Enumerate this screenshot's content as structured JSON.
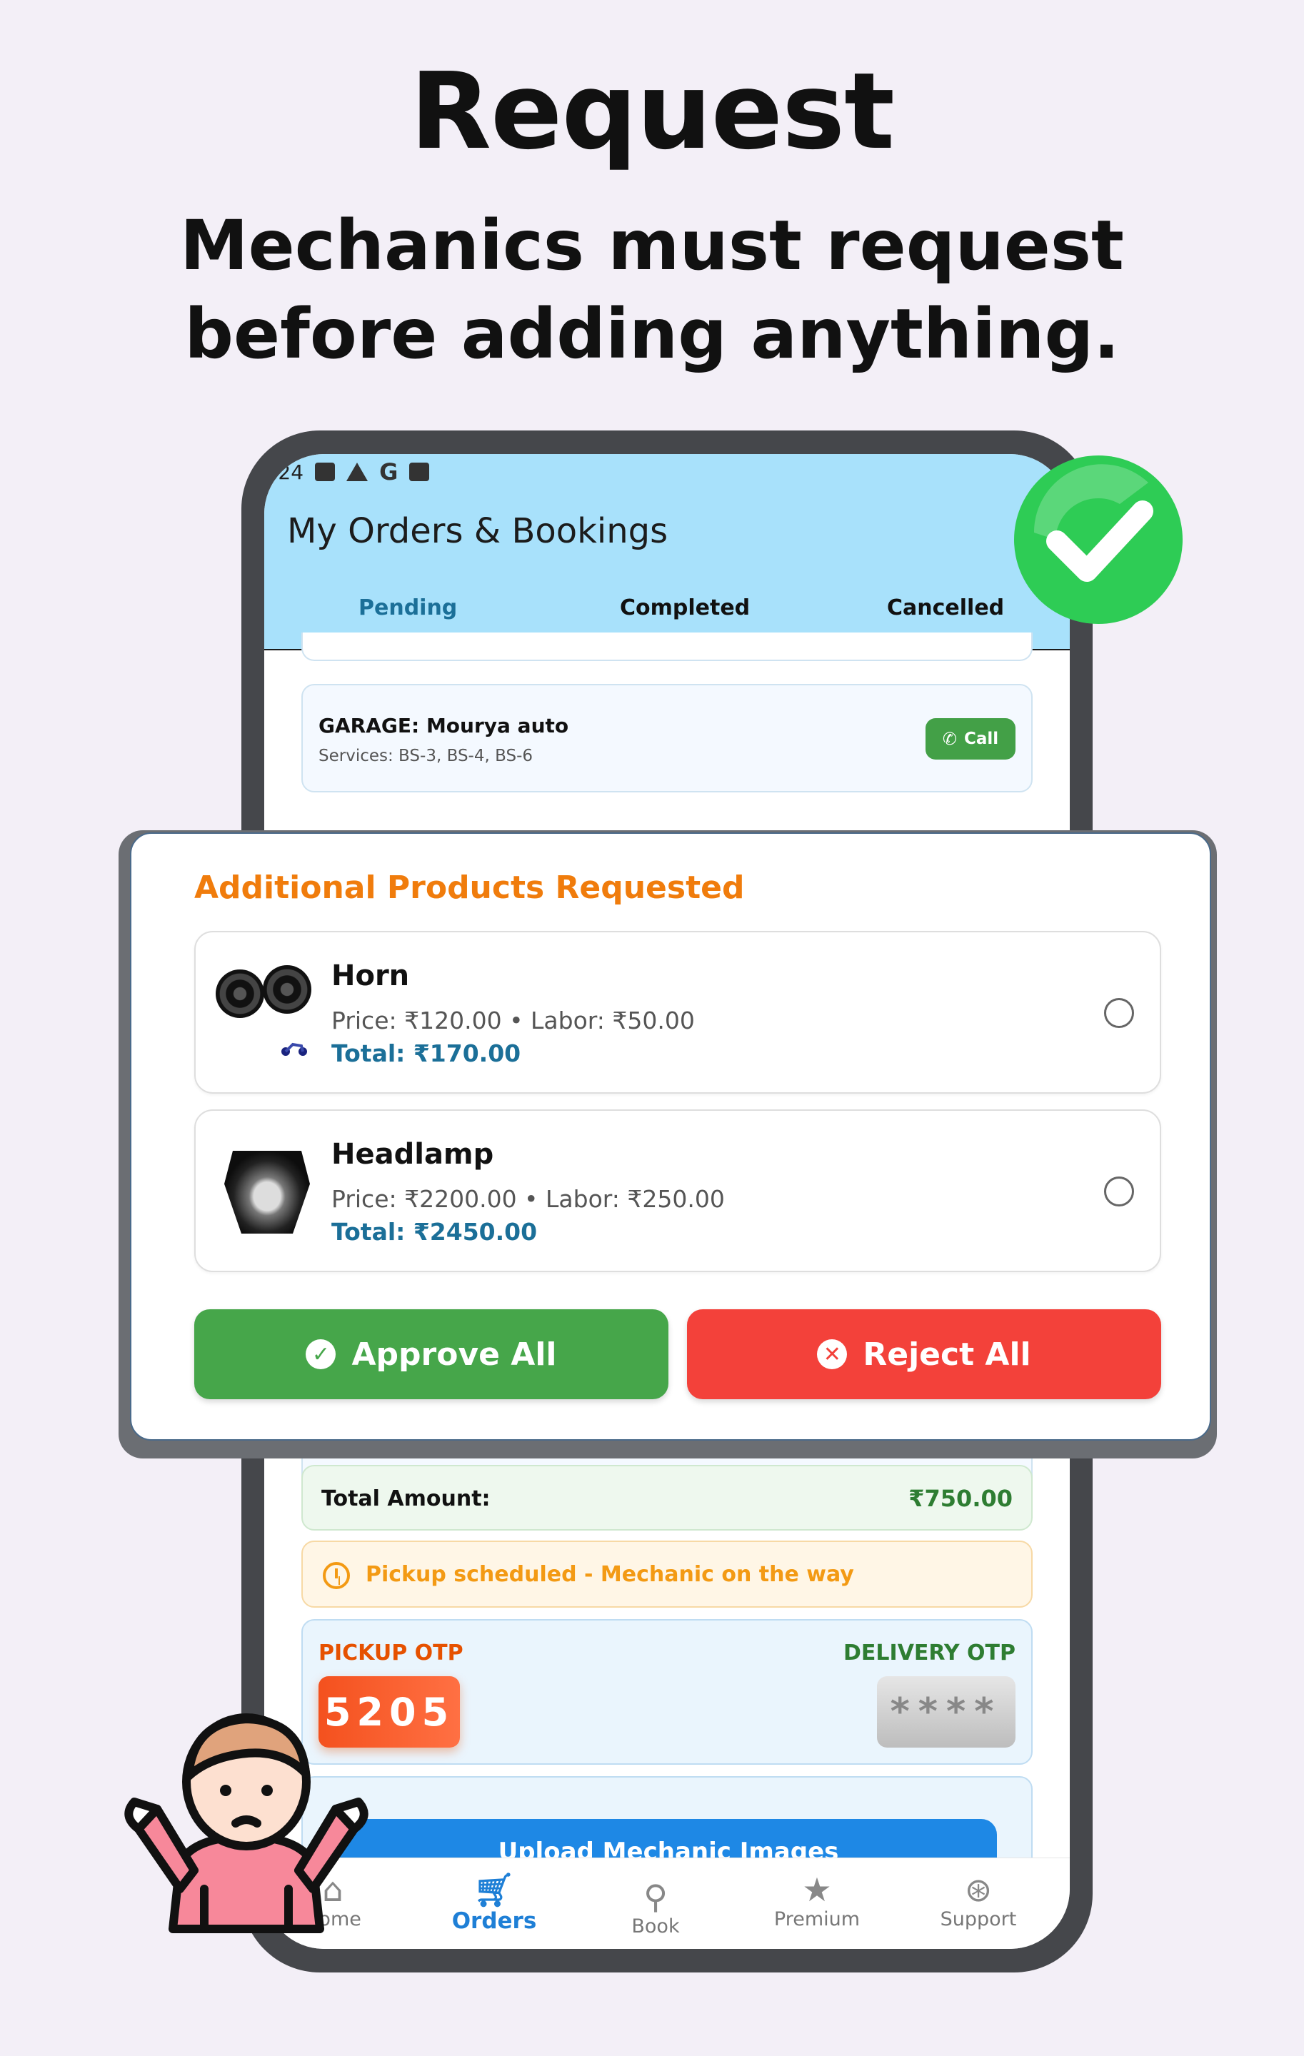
{
  "headline": "Request",
  "subheadline": [
    "Mechanics must request",
    "before adding anything."
  ],
  "status_bar": {
    "time": ":24"
  },
  "app": {
    "title": "My Orders & Bookings",
    "tabs": [
      {
        "label": "Pending",
        "active": true
      },
      {
        "label": "Completed",
        "active": false
      },
      {
        "label": "Cancelled",
        "active": false
      }
    ]
  },
  "garage": {
    "title": "GARAGE: Mourya auto",
    "services": "Services: BS-3, BS-4, BS-6",
    "call_label": "Call"
  },
  "total": {
    "label": "Total Amount:",
    "value": "₹750.00"
  },
  "pickup_status": "Pickup scheduled - Mechanic on the way",
  "otp": {
    "pickup_label": "PICKUP OTP",
    "pickup_code": "5205",
    "delivery_label": "DELIVERY OTP",
    "delivery_code": "****"
  },
  "upload_label": "Upload Mechanic Images",
  "bottom_nav": [
    {
      "label": "Home",
      "icon": "home-icon",
      "active": false
    },
    {
      "label": "Orders",
      "icon": "cart-icon",
      "active": true
    },
    {
      "label": "Book",
      "icon": "bike-icon",
      "active": false
    },
    {
      "label": "Premium",
      "icon": "star-icon",
      "active": false
    },
    {
      "label": "Support",
      "icon": "support-icon",
      "active": false
    }
  ],
  "dialog": {
    "title": "Additional Products Requested",
    "items": [
      {
        "name": "Horn",
        "price_line": "Price: ₹120.00 • Labor: ₹50.00",
        "total": "Total: ₹170.00",
        "image": "horn-image"
      },
      {
        "name": "Headlamp",
        "price_line": "Price: ₹2200.00 • Labor: ₹250.00",
        "total": "Total: ₹2450.00",
        "image": "headlamp-image"
      }
    ],
    "approve_label": "Approve All",
    "reject_label": "Reject All"
  },
  "colors": {
    "appbar": "#a8e1fb",
    "accent_blue": "#1b6f98",
    "approve": "#46a64a",
    "reject": "#f3413a",
    "dialog_title": "#f07c0c"
  }
}
